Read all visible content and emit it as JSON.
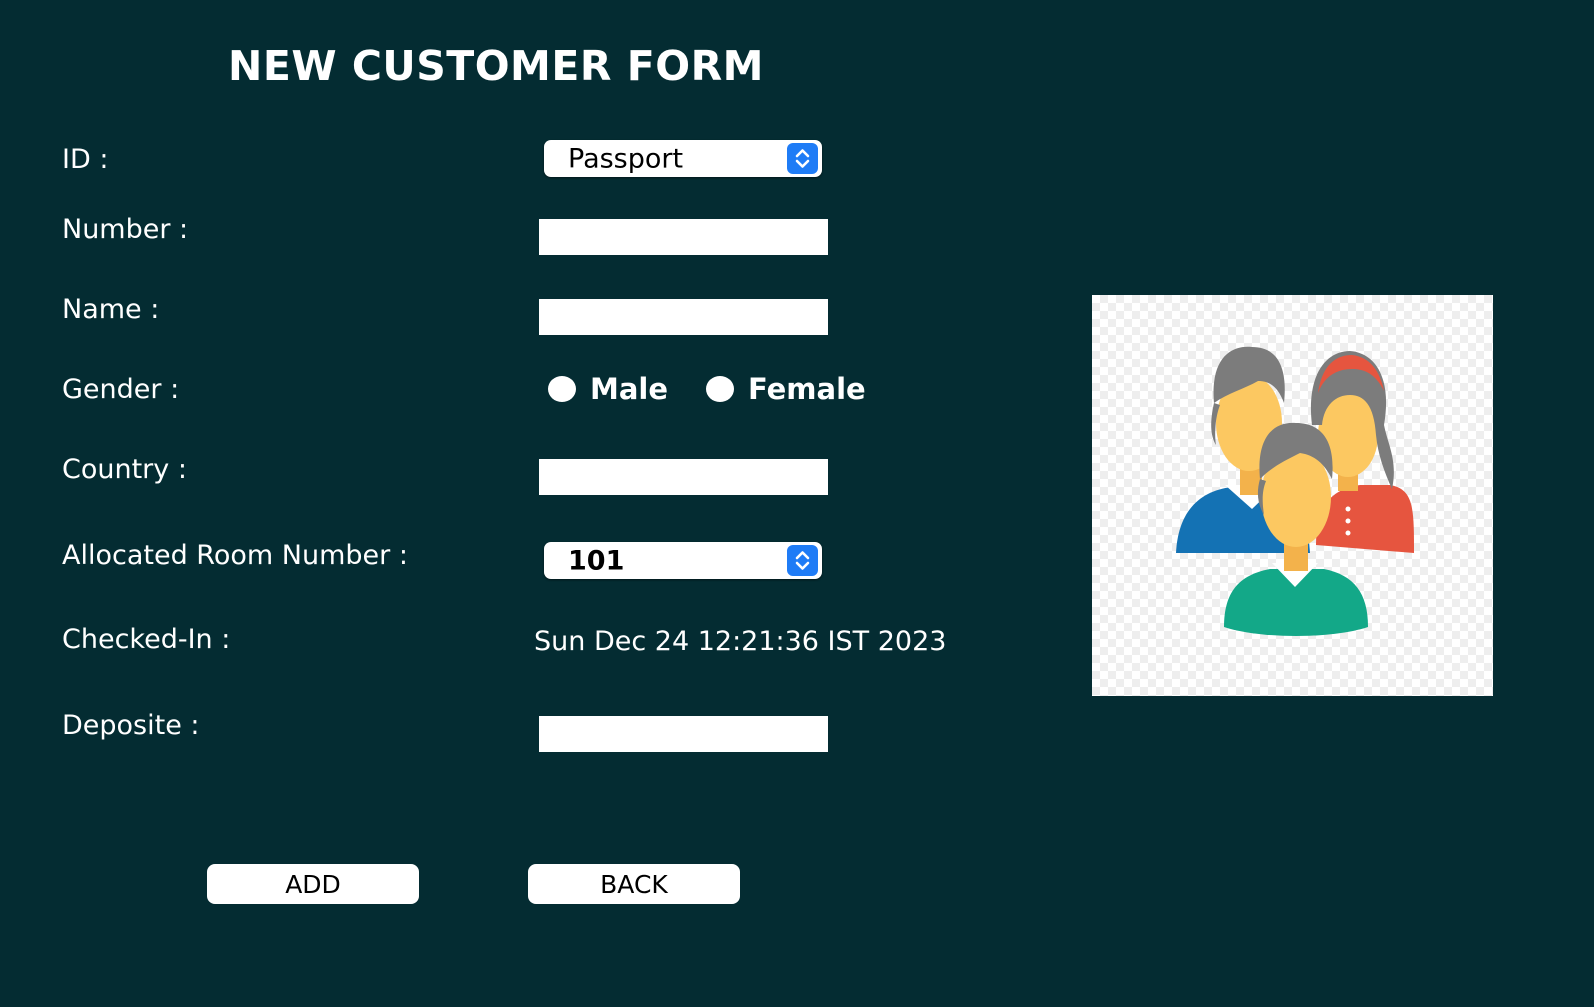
{
  "form": {
    "title": "NEW CUSTOMER FORM"
  },
  "labels": {
    "id": "ID :",
    "number": "Number :",
    "name": "Name :",
    "gender": "Gender :",
    "country": "Country :",
    "room": "Allocated Room Number :",
    "checked_in": "Checked-In :",
    "deposit": "Deposite :"
  },
  "fields": {
    "id_type": {
      "selected": "Passport"
    },
    "number": {
      "value": ""
    },
    "name": {
      "value": ""
    },
    "gender": {
      "options": [
        "Male",
        "Female"
      ],
      "selected": null
    },
    "country": {
      "value": ""
    },
    "room_number": {
      "selected": "101"
    },
    "checked_in": "Sun Dec 24 12:21:36 IST 2023",
    "deposit": {
      "value": ""
    }
  },
  "buttons": {
    "add": "ADD",
    "back": "BACK"
  },
  "image": {
    "icon": "customers-group-icon"
  },
  "colors": {
    "background": "#042c32",
    "text": "#ffffff",
    "stepper_accent": "#1f7cf6",
    "person_blue": "#1472b4",
    "person_red": "#e6553f",
    "person_green": "#13a888",
    "skin": "#fcc861",
    "hair": "#7c7c7c"
  }
}
